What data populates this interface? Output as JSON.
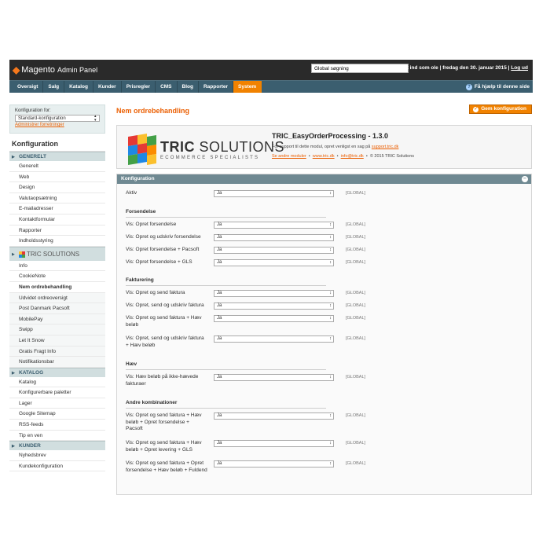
{
  "header": {
    "logo_brand": "Magento",
    "logo_sub": "Admin Panel",
    "search_value": "Global søgning",
    "login_text": "Logget ind som ole  |  fredag den 30. januar 2015  |",
    "logout": "Log ud"
  },
  "nav": {
    "items": [
      "Oversigt",
      "Salg",
      "Katalog",
      "Kunder",
      "Prisregler",
      "CMS",
      "Blog",
      "Rapporter",
      "System"
    ],
    "help": "Få hjælp til denne side"
  },
  "sidebar": {
    "store_label": "Konfiguration for:",
    "store_value": "Standard-konfiguration",
    "store_link": "Administrer forretninger",
    "title": "Konfiguration",
    "general_header": "GENERELT",
    "general_items": [
      "Generelt",
      "Web",
      "Design",
      "Valutaopsætning",
      "E-mailadresser",
      "Kontaktformular",
      "Rapporter",
      "Indholdsstyring"
    ],
    "tric_header": "TRIC SOLUTIONS",
    "tric_items": [
      "Info",
      "CookieNote",
      "Nem ordrebehandling",
      "Udvidet ordreoversigt",
      "Post Danmark Pacsoft",
      "MobilePay",
      "Swipp",
      "Let It Snow",
      "Gratis Fragt Info",
      "Notifikationsbar"
    ],
    "catalog_header": "KATALOG",
    "catalog_items": [
      "Katalog",
      "Konfigurerbare paletter",
      "Lager",
      "Google Sitemap",
      "RSS-feeds",
      "Tip en ven"
    ],
    "customers_header": "KUNDER",
    "customers_items": [
      "Nyhedsbrev",
      "Kundekonfiguration"
    ]
  },
  "main": {
    "title": "Nem ordrebehandling",
    "save_label": "Gem konfiguration",
    "tric": {
      "brand_bold": "TRIC",
      "brand_rest": " SOLUTIONS",
      "tagline": "ECOMMERCE SPECIALISTS",
      "module_title": "TRIC_EasyOrderProcessing - 1.3.0",
      "support_text": "For support til dette modul, opret venligst en sag på",
      "support_link": "support.tric.dk",
      "link_modules": "Se andre moduler",
      "link_site": "www.tric.dk",
      "link_email": "info@tric.dk",
      "copyright": "© 2015 TRIC Solutions"
    },
    "config": {
      "header": "Konfiguration",
      "aktiv_label": "Aktiv",
      "aktiv_value": "Ja",
      "scope": "[GLOBAL]",
      "sections": [
        {
          "title": "Forsendelse",
          "rows": [
            {
              "label": "Vis: Opret forsendelse",
              "value": "Ja"
            },
            {
              "label": "Vis: Opret og udskriv forsendelse",
              "value": "Ja"
            },
            {
              "label": "Vis: Opret forsendelse + Pacsoft",
              "value": "Ja"
            },
            {
              "label": "Vis: Opret forsendelse + GLS",
              "value": "Ja"
            }
          ]
        },
        {
          "title": "Fakturering",
          "rows": [
            {
              "label": "Vis: Opret og send faktura",
              "value": "Ja"
            },
            {
              "label": "Vis: Opret, send og udskriv faktura",
              "value": "Ja"
            },
            {
              "label": "Vis: Opret og send faktura + Hæv beløb",
              "value": "Ja"
            },
            {
              "label": "Vis: Opret, send og udskriv faktura + Hæv beløb",
              "value": "Ja"
            }
          ]
        },
        {
          "title": "Hæv",
          "rows": [
            {
              "label": "Vis: Hæv beløb på ikke-hævede fakturaer",
              "value": "Ja"
            }
          ]
        },
        {
          "title": "Andre kombinationer",
          "rows": [
            {
              "label": "Vis: Opret og send faktura + Hæv beløb + Opret forsendelse + Pacsoft",
              "value": "Ja"
            },
            {
              "label": "Vis: Opret og send faktura + Hæv beløb + Opret levering + GLS",
              "value": "Ja"
            },
            {
              "label": "Vis: Opret og send faktura + Opret forsendelse + Hæv beløb + Fuldend",
              "value": "Ja"
            }
          ]
        }
      ]
    }
  },
  "colors": {
    "accent": "#f18200",
    "nav": "#3b5e6f",
    "header": "#2a2a2a"
  }
}
